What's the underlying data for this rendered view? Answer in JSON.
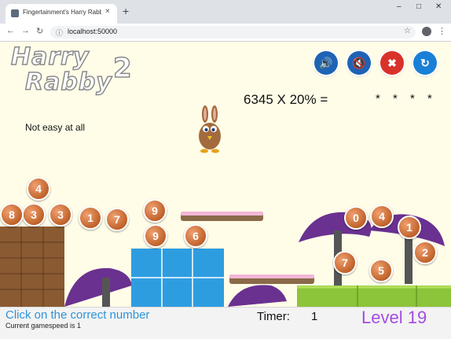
{
  "browser": {
    "tab_title": "Fingertainment's Harry Rabb",
    "url": "localhost:50000",
    "new_tab": "+",
    "tab_close": "×",
    "minimize": "–",
    "maximize": "□",
    "window_close": "✕"
  },
  "game": {
    "logo_line1": "Harry",
    "logo_line2": "Rabby",
    "logo_number": "2",
    "question": "6345 X 20% =",
    "answer_mask": "* * * *",
    "difficulty": "Not easy at all",
    "controls": [
      {
        "name": "sound-on-button",
        "icon": "speaker-on-icon",
        "glyph": "🔊",
        "color": "#1f63b5"
      },
      {
        "name": "sound-off-button",
        "icon": "speaker-mute-icon",
        "glyph": "🔇",
        "color": "#1f63b5"
      },
      {
        "name": "quit-button",
        "icon": "close-icon",
        "glyph": "✖",
        "color": "#d9322b"
      },
      {
        "name": "restart-button",
        "icon": "refresh-icon",
        "glyph": "↻",
        "color": "#1a7fd6"
      }
    ],
    "number_balls": [
      "4",
      "9",
      "3",
      "3",
      "1",
      "7",
      "9",
      "6",
      "0",
      "4",
      "1",
      "7",
      "2",
      "5",
      "8"
    ]
  },
  "status": {
    "instruction": "Click on the correct number",
    "speed": "Current gamespeed is 1",
    "timer_label": "Timer:",
    "timer_value": "1",
    "level": "Level 19"
  }
}
